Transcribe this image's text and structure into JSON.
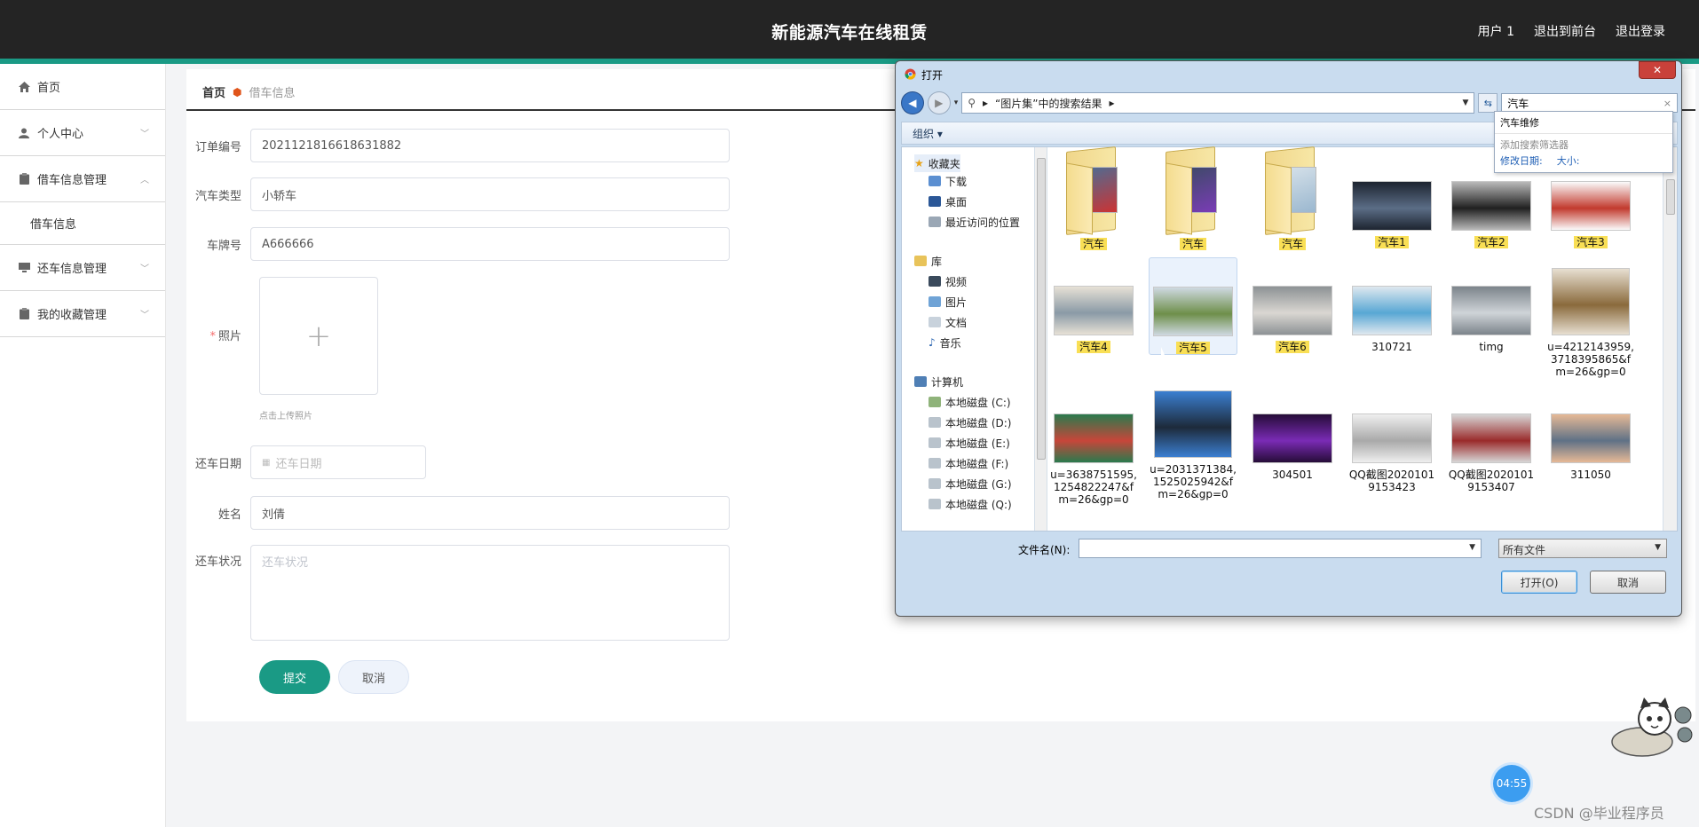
{
  "header": {
    "title": "新能源汽车在线租赁",
    "links": [
      "用户 1",
      "退出到前台",
      "退出登录"
    ]
  },
  "sidebar": {
    "items": [
      {
        "label": "首页",
        "icon": "home-icon"
      },
      {
        "label": "个人中心",
        "icon": "user-icon",
        "chevron": "down"
      },
      {
        "label": "借车信息管理",
        "icon": "clipboard-icon",
        "chevron": "up",
        "sub": "借车信息"
      },
      {
        "label": "还车信息管理",
        "icon": "monitor-icon",
        "chevron": "down"
      },
      {
        "label": "我的收藏管理",
        "icon": "clipboard-icon",
        "chevron": "down"
      }
    ]
  },
  "breadcrumb": {
    "home": "首页",
    "current": "借车信息"
  },
  "form": {
    "order_no": {
      "label": "订单编号",
      "value": "20211218166186​31882"
    },
    "car_type": {
      "label": "汽车类型",
      "value": "小轿车"
    },
    "plate": {
      "label": "车牌号",
      "value": "A666666"
    },
    "photo": {
      "label": "照片",
      "hint": "点击上传照片"
    },
    "return_date": {
      "label": "还车日期",
      "placeholder": "还车日期"
    },
    "name": {
      "label": "姓名",
      "value": "刘倩"
    },
    "status": {
      "label": "还车状况",
      "placeholder": "还车状况"
    },
    "submit": "提交",
    "cancel": "取消"
  },
  "dialog": {
    "title": "打开",
    "address": "“图片集”中的搜索结果",
    "search": "汽车",
    "suggest": {
      "item": "汽车维修",
      "add_filter": "添加搜索筛选器",
      "filter1": "修改日期:",
      "filter2": "大小:"
    },
    "toolbar": "组织",
    "tree": {
      "favorites": "收藏夹",
      "fav_items": [
        "下载",
        "桌面",
        "最近访问的位置"
      ],
      "library": "库",
      "lib_items": [
        "视频",
        "图片",
        "文档",
        "音乐"
      ],
      "computer": "计算机",
      "drives": [
        "本地磁盘 (C:)",
        "本地磁盘 (D:)",
        "本地磁盘 (E:)",
        "本地磁盘 (F:)",
        "本地磁盘 (G:)",
        "本地磁盘 (Q:)"
      ]
    },
    "files": [
      {
        "name": "汽车",
        "kind": "folder",
        "hl": true
      },
      {
        "name": "汽车",
        "kind": "folder",
        "hl": true
      },
      {
        "name": "汽车",
        "kind": "folder",
        "hl": true
      },
      {
        "name": "汽车1",
        "kind": "image",
        "hl": true
      },
      {
        "name": "汽车2",
        "kind": "image",
        "hl": true
      },
      {
        "name": "汽车3",
        "kind": "image",
        "hl": true
      },
      {
        "name": "汽车4",
        "kind": "image",
        "hl": true
      },
      {
        "name": "汽车5",
        "kind": "image",
        "hl": true
      },
      {
        "name": "汽车6",
        "kind": "image",
        "hl": true
      },
      {
        "name": "310721",
        "kind": "image",
        "hl": false
      },
      {
        "name": "timg",
        "kind": "image",
        "hl": false
      },
      {
        "name": "u=4212143959,3718395865&fm=26&gp=0",
        "kind": "image",
        "hl": false
      },
      {
        "name": "u=3638751595,1254822247&fm=26&gp=0",
        "kind": "image",
        "hl": false
      },
      {
        "name": "u=2031371384,1525025942&fm=26&gp=0",
        "kind": "image",
        "hl": false
      },
      {
        "name": "304501",
        "kind": "image",
        "hl": false
      },
      {
        "name": "QQ截图20201019153423",
        "kind": "image",
        "hl": false
      },
      {
        "name": "QQ截图20201019153407",
        "kind": "image",
        "hl": false
      },
      {
        "name": "311050",
        "kind": "image",
        "hl": false
      }
    ],
    "filename_label": "文件名(N):",
    "filter": "所有文件",
    "open": "打开(O)",
    "cancel": "取消"
  },
  "overlay": {
    "timer": "04:55",
    "watermark": "CSDN @毕业程序员"
  },
  "colors": {
    "accent": "#1a9a85",
    "header": "#242424",
    "highlight": "#f9df55"
  }
}
